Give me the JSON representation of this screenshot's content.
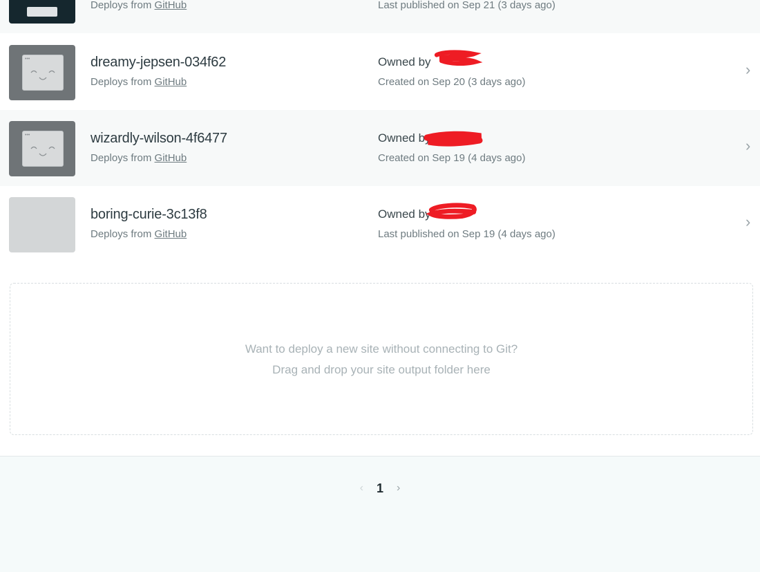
{
  "sites": [
    {
      "name": "",
      "deploys_prefix": "Deploys from",
      "deploys_link": "GitHub",
      "owned_prefix": "",
      "date_text": "Last published on Sep 21 (3 days ago)"
    },
    {
      "name": "dreamy-jepsen-034f62",
      "deploys_prefix": "Deploys from",
      "deploys_link": "GitHub",
      "owned_prefix": "Owned by",
      "date_text": "Created on Sep 20 (3 days ago)"
    },
    {
      "name": "wizardly-wilson-4f6477",
      "deploys_prefix": "Deploys from",
      "deploys_link": "GitHub",
      "owned_prefix": "Owned by",
      "date_text": "Created on Sep 19 (4 days ago)"
    },
    {
      "name": "boring-curie-3c13f8",
      "deploys_prefix": "Deploys from",
      "deploys_link": "GitHub",
      "owned_prefix": "Owned by",
      "date_text": "Last published on Sep 19 (4 days ago)"
    }
  ],
  "icons": {
    "row_chevron": "›",
    "thumb_smiley": "smiley-window-icon"
  },
  "dropzone": {
    "line1": "Want to deploy a new site without connecting to Git?",
    "line2": "Drag and drop your site output folder here"
  },
  "pagination": {
    "prev": "‹",
    "current": "1",
    "next": "›"
  },
  "colors": {
    "redaction": "#ee1c24",
    "page_background": "#f5fafa"
  }
}
